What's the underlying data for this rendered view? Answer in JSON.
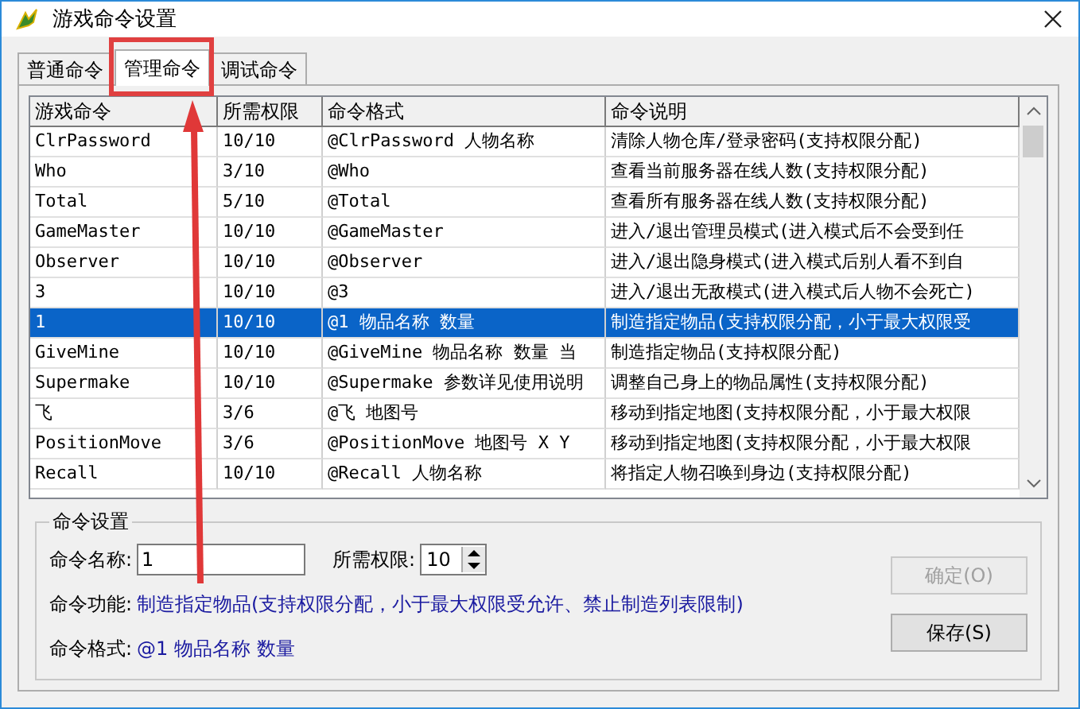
{
  "window": {
    "title": "游戏命令设置"
  },
  "tabs": [
    {
      "label": "普通命令",
      "selected": false
    },
    {
      "label": "管理命令",
      "selected": true
    },
    {
      "label": "调试命令",
      "selected": false
    }
  ],
  "table": {
    "columns": [
      "游戏命令",
      "所需权限",
      "命令格式",
      "命令说明"
    ],
    "rows": [
      {
        "cells": [
          "ClrPassword",
          "10/10",
          "@ClrPassword 人物名称",
          "清除人物仓库/登录密码(支持权限分配)"
        ],
        "selected": false
      },
      {
        "cells": [
          "Who",
          "3/10",
          "@Who",
          "查看当前服务器在线人数(支持权限分配)"
        ],
        "selected": false
      },
      {
        "cells": [
          "Total",
          "5/10",
          "@Total",
          "查看所有服务器在线人数(支持权限分配)"
        ],
        "selected": false
      },
      {
        "cells": [
          "GameMaster",
          "10/10",
          "@GameMaster",
          "进入/退出管理员模式(进入模式后不会受到任"
        ],
        "selected": false
      },
      {
        "cells": [
          "Observer",
          "10/10",
          "@Observer",
          "进入/退出隐身模式(进入模式后别人看不到自"
        ],
        "selected": false
      },
      {
        "cells": [
          "3",
          "10/10",
          "@3",
          "进入/退出无敌模式(进入模式后人物不会死亡)"
        ],
        "selected": false
      },
      {
        "cells": [
          "1",
          "10/10",
          "@1 物品名称 数量",
          "制造指定物品(支持权限分配，小于最大权限受"
        ],
        "selected": true
      },
      {
        "cells": [
          "GiveMine",
          "10/10",
          "@GiveMine 物品名称 数量 当",
          "制造指定物品(支持权限分配)"
        ],
        "selected": false
      },
      {
        "cells": [
          "Supermake",
          "10/10",
          "@Supermake 参数详见使用说明",
          "调整自己身上的物品属性(支持权限分配)"
        ],
        "selected": false
      },
      {
        "cells": [
          "飞",
          "3/6",
          "@飞 地图号",
          "移动到指定地图(支持权限分配，小于最大权限"
        ],
        "selected": false
      },
      {
        "cells": [
          "PositionMove",
          "3/6",
          "@PositionMove 地图号 X Y",
          "移动到指定地图(支持权限分配，小于最大权限"
        ],
        "selected": false
      },
      {
        "cells": [
          "Recall",
          "10/10",
          "@Recall 人物名称",
          "将指定人物召唤到身边(支持权限分配)"
        ],
        "selected": false
      }
    ]
  },
  "settings": {
    "title": "命令设置",
    "name_label": "命令名称:",
    "name_value": "1",
    "permission_label": "所需权限:",
    "permission_value": "10",
    "function_label": "命令功能:",
    "function_text": "制造指定物品(支持权限分配，小于最大权限受允许、禁止制造列表限制)",
    "format_label": "命令格式:",
    "format_text": "@1 物品名称 数量"
  },
  "buttons": [
    {
      "label": "确定(O)",
      "disabled": true
    },
    {
      "label": "保存(S)",
      "disabled": false
    }
  ]
}
